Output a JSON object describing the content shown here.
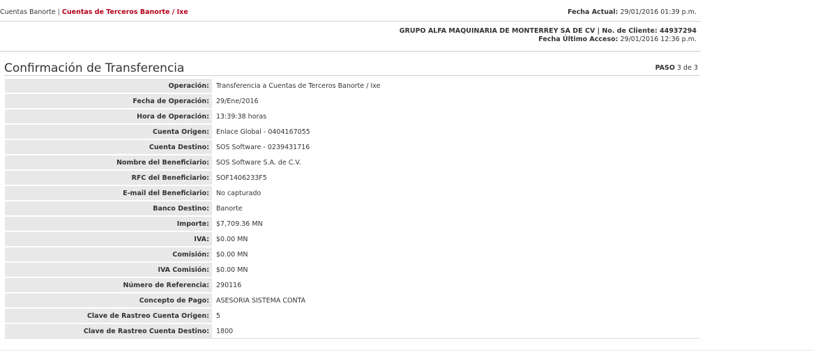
{
  "breadcrumb": {
    "previous": "Cuentas Banorte",
    "separator": "|",
    "current": "Cuentas de Terceros Banorte / Ixe"
  },
  "header": {
    "fecha_actual_label": "Fecha Actual:",
    "fecha_actual_value": "29/01/2016 01:39 p.m.",
    "client_line": "GRUPO ALFA MAQUINARIA DE MONTERREY SA DE CV | No. de Cliente: 44937294",
    "ultimo_acceso_label": "Fecha Último Acceso:",
    "ultimo_acceso_value": "29/01/2016 12:36 p.m."
  },
  "page": {
    "title": "Confirmación de Transferencia",
    "paso_label": "PASO",
    "paso_value": "3 de 3"
  },
  "details": [
    {
      "label": "Operación:",
      "value": "Transferencia a Cuentas de Terceros Banorte / Ixe"
    },
    {
      "label": "Fecha de Operación:",
      "value": "29/Ene/2016"
    },
    {
      "label": "Hora de Operación:",
      "value": "13:39:38 horas"
    },
    {
      "label": "Cuenta Origen:",
      "value": "Enlace Global - 0404167055"
    },
    {
      "label": "Cuenta Destino:",
      "value": "SOS Software - 0239431716"
    },
    {
      "label": "Nombre del Beneficiario:",
      "value": "SOS Software S.A. de C.V."
    },
    {
      "label": "RFC del Beneficiario:",
      "value": "SOF1406233F5"
    },
    {
      "label": "E-mail del Beneficiario:",
      "value": "No capturado"
    },
    {
      "label": "Banco Destino:",
      "value": "Banorte"
    },
    {
      "label": "Importe:",
      "value": "$7,709.36 MN"
    },
    {
      "label": "IVA:",
      "value": "$0.00 MN"
    },
    {
      "label": "Comisión:",
      "value": "$0.00 MN"
    },
    {
      "label": "IVA Comisión:",
      "value": "$0.00 MN"
    },
    {
      "label": "Número de Referencia:",
      "value": "290116"
    },
    {
      "label": "Concepto de Pago:",
      "value": "ASESORIA SISTEMA CONTA"
    },
    {
      "label": "Clave de Rastreo Cuenta Origen:",
      "value": "5"
    },
    {
      "label": "Clave de Rastreo Cuenta Destino:",
      "value": "1800"
    }
  ],
  "colors": {
    "accent": "#b3001b",
    "label_bg": "#e8e8e8",
    "divider": "#cfcfcf"
  }
}
